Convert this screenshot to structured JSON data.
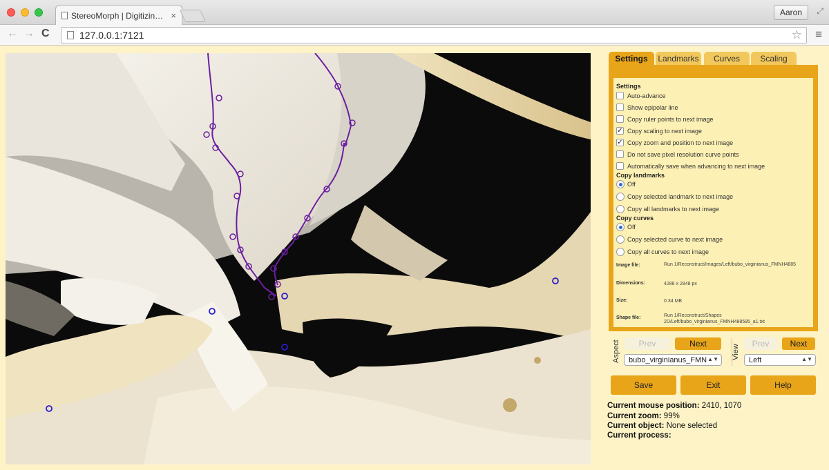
{
  "browser": {
    "tab_title": "StereoMorph | Digitizing A",
    "tab_close": "×",
    "profile_name": "Aaron",
    "address": "127.0.0.1:7121",
    "fullscreen_glyph": "⤢",
    "back_glyph": "←",
    "forward_glyph": "→",
    "reload_glyph": "C",
    "star_glyph": "☆",
    "menu_glyph": "≡"
  },
  "panel": {
    "tabs": [
      {
        "label": "Settings",
        "active": true
      },
      {
        "label": "Landmarks",
        "active": false
      },
      {
        "label": "Curves",
        "active": false
      },
      {
        "label": "Scaling",
        "active": false
      }
    ],
    "settings_title": "Settings",
    "options": [
      {
        "label": "Auto-advance",
        "checked": false
      },
      {
        "label": "Show epipolar line",
        "checked": false
      },
      {
        "label": "Copy ruler points to next image",
        "checked": false
      },
      {
        "label": "Copy scaling to next image",
        "checked": true
      },
      {
        "label": "Copy zoom and position to next image",
        "checked": true
      },
      {
        "label": "Do not save pixel resolution curve points",
        "checked": false
      },
      {
        "label": "Automatically save when advancing to next image",
        "checked": false
      }
    ],
    "copy_landmarks_title": "Copy landmarks",
    "copy_landmarks": [
      {
        "label": "Off",
        "selected": true
      },
      {
        "label": "Copy selected landmark to next image",
        "selected": false
      },
      {
        "label": "Copy all landmarks to next image",
        "selected": false
      }
    ],
    "copy_curves_title": "Copy curves",
    "copy_curves": [
      {
        "label": "Off",
        "selected": true
      },
      {
        "label": "Copy selected curve to next image",
        "selected": false
      },
      {
        "label": "Copy all curves to next image",
        "selected": false
      }
    ],
    "info": {
      "image_file_label": "Image file:",
      "image_file_value": "Run 1/Reconstruct/Images/Left/bubo_virginianus_FMNH4885",
      "dimensions_label": "Dimensions:",
      "dimensions_value": "4288 x 2848 px",
      "size_label": "Size:",
      "size_value": "0.34 MB",
      "shape_file_label": "Shape file:",
      "shape_file_value": "Run 1/Reconstruct/Shapes 2D/Left/bubo_virginianus_FMNH488595_a1.txt"
    },
    "aspect": {
      "label": "Aspect",
      "prev": "Prev",
      "next": "Next",
      "selected": "bubo_virginianus_FMN"
    },
    "view": {
      "label": "View",
      "prev": "Prev",
      "next": "Next",
      "selected": "Left"
    },
    "buttons": {
      "save": "Save",
      "exit": "Exit",
      "help": "Help"
    },
    "status": {
      "mouse_label": "Current mouse position:",
      "mouse_value": "2410, 1070",
      "zoom_label": "Current zoom:",
      "zoom_value": "99%",
      "object_label": "Current object:",
      "object_value": "None selected",
      "process_label": "Current process:",
      "process_value": ""
    }
  },
  "colors": {
    "accent": "#e8a51a",
    "panel_bg": "#fdf3c6",
    "curve": "#6b1fa0",
    "landmark": "#2a1ccc"
  }
}
